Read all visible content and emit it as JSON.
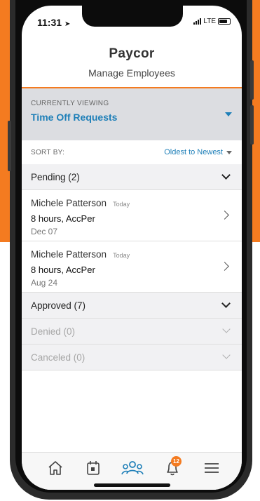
{
  "status_bar": {
    "time": "11:31",
    "carrier": "LTE"
  },
  "header": {
    "logo": "Paycor",
    "title": "Manage Employees"
  },
  "viewing": {
    "label": "CURRENTLY VIEWING",
    "value": "Time Off Requests"
  },
  "sort": {
    "label": "SORT BY:",
    "value": "Oldest to Newest"
  },
  "groups": {
    "pending": {
      "label": "Pending (2)"
    },
    "approved": {
      "label": "Approved (7)"
    },
    "denied": {
      "label": "Denied (0)"
    },
    "canceled": {
      "label": "Canceled (0)"
    }
  },
  "requests": [
    {
      "name": "Michele Patterson",
      "day": "Today",
      "detail": "8 hours, AccPer",
      "date": "Dec 07"
    },
    {
      "name": "Michele Patterson",
      "day": "Today",
      "detail": "8 hours, AccPer",
      "date": "Aug 24"
    }
  ],
  "tabbar": {
    "tabs": [
      {
        "icon": "home-icon"
      },
      {
        "icon": "calendar-icon"
      },
      {
        "icon": "people-icon",
        "active": true
      },
      {
        "icon": "bell-icon"
      },
      {
        "icon": "menu-icon"
      }
    ],
    "notification_count": "12"
  },
  "colors": {
    "brand_orange": "#f47b20",
    "accent_blue": "#1e7fb8",
    "selector_bg": "#dcdde1",
    "group_bg": "#f1f1f3"
  }
}
